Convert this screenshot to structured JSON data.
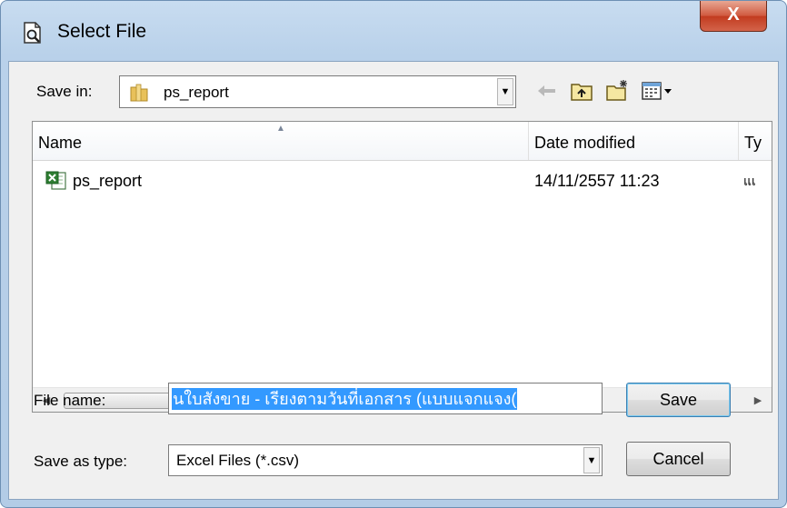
{
  "window": {
    "title": "Select File",
    "close_label": "X"
  },
  "save_in": {
    "label": "Save in:",
    "value": "ps_report"
  },
  "toolbar": {
    "back_icon": "back-arrow-icon",
    "up_icon": "up-folder-icon",
    "new_folder_icon": "new-folder-icon",
    "view_menu_icon": "view-menu-icon"
  },
  "list": {
    "columns": [
      "Name",
      "Date modified",
      "Ty"
    ],
    "files": [
      {
        "name": "ps_report",
        "date_modified": "14/11/2557 11:23",
        "type": "แเ"
      }
    ],
    "scroll_grip": "III"
  },
  "file_name": {
    "label": "File name:",
    "value": "นใบสังขาย - เรียงตามวันที่เอกสาร (แบบแจกแจง("
  },
  "save_as_type": {
    "label": "Save as type:",
    "value": "Excel Files (*.csv)"
  },
  "buttons": {
    "save": "Save",
    "cancel": "Cancel"
  },
  "colors": {
    "selection": "#3399ff",
    "title_gradient": "#c8dcf0",
    "close_red": "#c23b1f"
  }
}
